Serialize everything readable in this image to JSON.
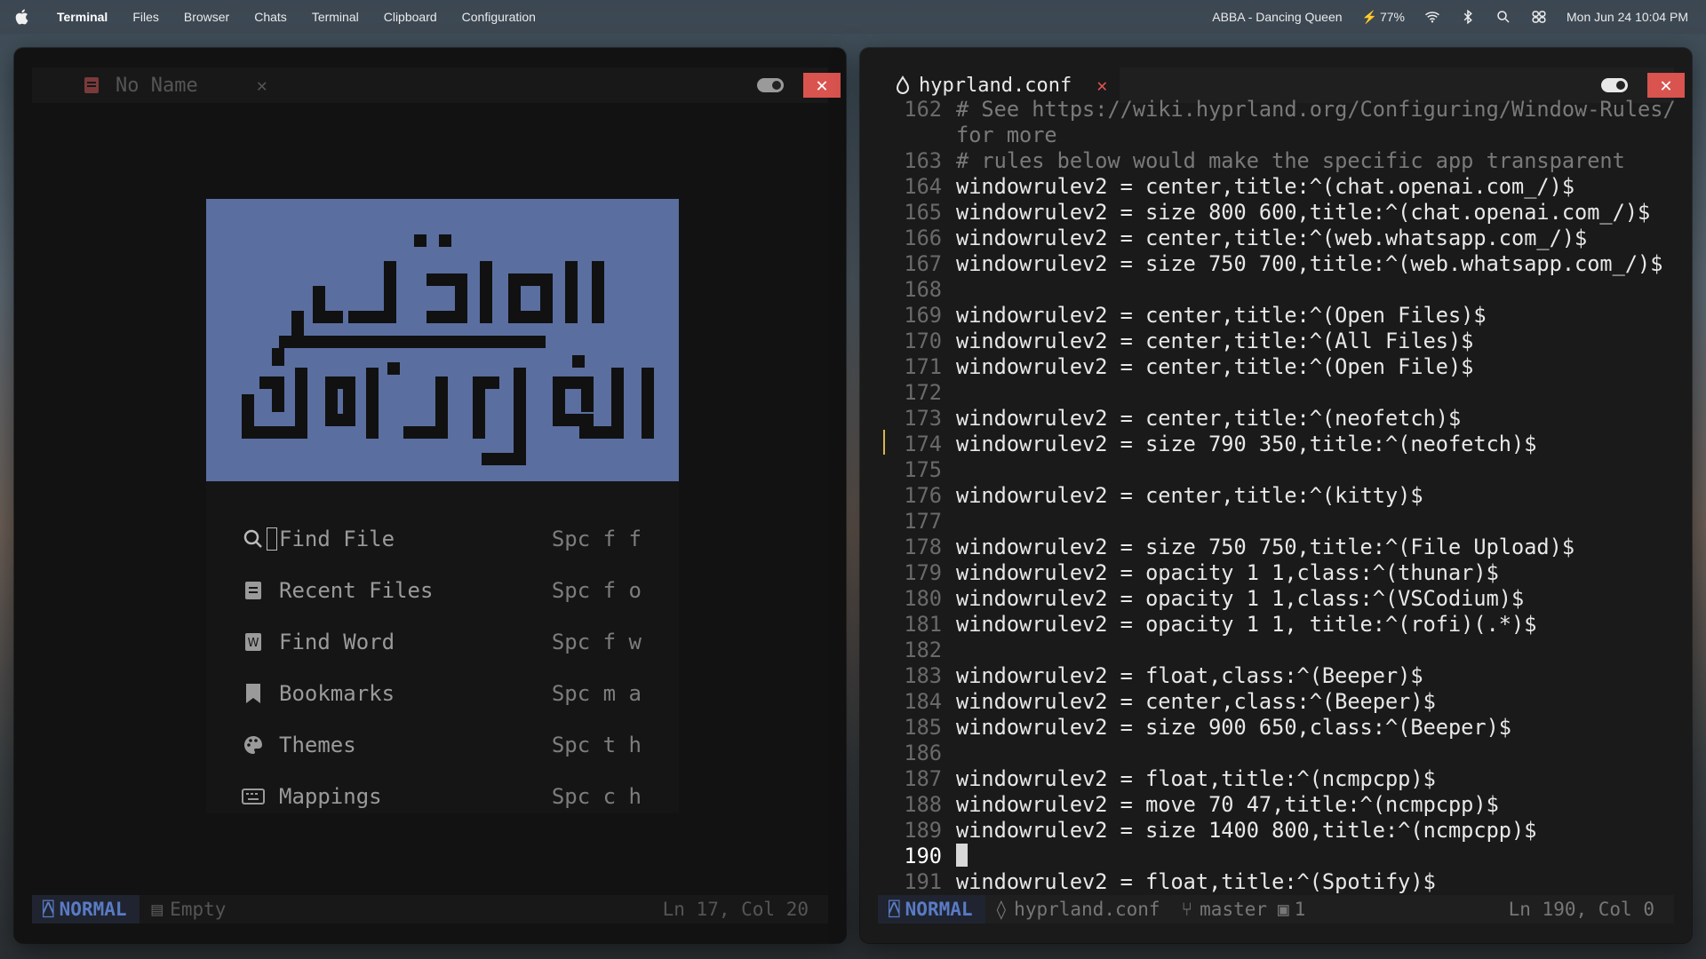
{
  "menubar": {
    "items": [
      "Terminal",
      "Files",
      "Browser",
      "Chats",
      "Terminal",
      "Clipboard",
      "Configuration"
    ],
    "now_playing": "ABBA - Dancing Queen",
    "battery": "77%",
    "datetime": "Mon Jun 24  10:04 PM"
  },
  "left_window": {
    "tab_label": "No Name",
    "tab_close": "✕",
    "close_glyph": "✕",
    "dashboard": [
      {
        "label": "Find File",
        "keys": "Spc f f",
        "icon": "search-icon"
      },
      {
        "label": "Recent Files",
        "keys": "Spc f o",
        "icon": "file-icon"
      },
      {
        "label": "Find Word",
        "keys": "Spc f w",
        "icon": "word-icon"
      },
      {
        "label": "Bookmarks",
        "keys": "Spc m a",
        "icon": "bookmark-icon"
      },
      {
        "label": "Themes",
        "keys": "Spc t h",
        "icon": "palette-icon"
      },
      {
        "label": "Mappings",
        "keys": "Spc c h",
        "icon": "keyboard-icon"
      }
    ],
    "status": {
      "mode": "NORMAL",
      "file": "Empty",
      "position": "Ln 17, Col 20"
    }
  },
  "right_window": {
    "tab_label": "hyprland.conf",
    "tab_close": "✕",
    "close_glyph": "✕",
    "lines": [
      {
        "n": "162",
        "text": "# See https://wiki.hyprland.org/Configuring/Window-Rules/",
        "comment": true
      },
      {
        "n": "",
        "text": "for more",
        "comment": true
      },
      {
        "n": "163",
        "text": "# rules below would make the specific app transparent",
        "comment": true
      },
      {
        "n": "164",
        "text": "windowrulev2 = center,title:^(chat.openai.com_/)$"
      },
      {
        "n": "165",
        "text": "windowrulev2 = size 800 600,title:^(chat.openai.com_/)$"
      },
      {
        "n": "166",
        "text": "windowrulev2 = center,title:^(web.whatsapp.com_/)$"
      },
      {
        "n": "167",
        "text": "windowrulev2 = size 750 700,title:^(web.whatsapp.com_/)$"
      },
      {
        "n": "168",
        "text": ""
      },
      {
        "n": "169",
        "text": "windowrulev2 = center,title:^(Open Files)$"
      },
      {
        "n": "170",
        "text": "windowrulev2 = center,title:^(All Files)$"
      },
      {
        "n": "171",
        "text": "windowrulev2 = center,title:^(Open File)$"
      },
      {
        "n": "172",
        "text": ""
      },
      {
        "n": "173",
        "text": "windowrulev2 = center,title:^(neofetch)$"
      },
      {
        "n": "174",
        "text": "windowrulev2 = size 790 350,title:^(neofetch)$"
      },
      {
        "n": "175",
        "text": ""
      },
      {
        "n": "176",
        "text": "windowrulev2 = center,title:^(kitty)$"
      },
      {
        "n": "177",
        "text": ""
      },
      {
        "n": "178",
        "text": "windowrulev2 = size 750 750,title:^(File Upload)$"
      },
      {
        "n": "179",
        "text": "windowrulev2 = opacity 1 1,class:^(thunar)$"
      },
      {
        "n": "180",
        "text": "windowrulev2 = opacity 1 1,class:^(VSCodium)$"
      },
      {
        "n": "181",
        "text": "windowrulev2 = opacity 1 1, title:^(rofi)(.*)$"
      },
      {
        "n": "182",
        "text": ""
      },
      {
        "n": "183",
        "text": "windowrulev2 = float,class:^(Beeper)$"
      },
      {
        "n": "184",
        "text": "windowrulev2 = center,class:^(Beeper)$"
      },
      {
        "n": "185",
        "text": "windowrulev2 = size 900 650,class:^(Beeper)$"
      },
      {
        "n": "186",
        "text": ""
      },
      {
        "n": "187",
        "text": "windowrulev2 = float,title:^(ncmpcpp)$"
      },
      {
        "n": "188",
        "text": "windowrulev2 = move 70 47,title:^(ncmpcpp)$"
      },
      {
        "n": "189",
        "text": "windowrulev2 = size 1400 800,title:^(ncmpcpp)$"
      },
      {
        "n": "190",
        "text": "",
        "cursor": true
      },
      {
        "n": "191",
        "text": "windowrulev2 = float,title:^(Spotify)$"
      }
    ],
    "status": {
      "mode": "NORMAL",
      "file": "hyprland.conf",
      "branch": "master",
      "buffers": "1",
      "position": "Ln 190, Col 0"
    }
  },
  "colors": {
    "accent": "#5a7bc4",
    "close": "#d9534f",
    "logo_bg": "#5a6ea0"
  }
}
